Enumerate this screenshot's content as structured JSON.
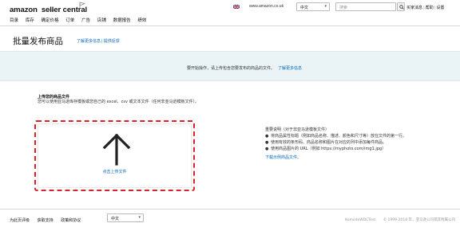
{
  "header": {
    "logo_main": "amazon",
    "logo_suffix": "seller central",
    "logo_region": "europe",
    "domain": "www.amazon.co.uk",
    "language": "中文",
    "search_placeholder": "搜索",
    "links": [
      "买家消息",
      "帮助",
      "设置"
    ]
  },
  "nav": {
    "items": [
      "目录",
      "库存",
      "确定价格",
      "订单",
      "广告",
      "店铺",
      "数据报告",
      "绩效"
    ]
  },
  "page": {
    "title": "批量发布商品",
    "links": [
      "了解更多信息",
      "提供反馈"
    ]
  },
  "banner": {
    "text": "要开始操作，请上传包含您要发布的商品的文件。",
    "link": "了解更多信息"
  },
  "upload": {
    "heading": "上传您的商品文件",
    "description": "您可以使用亚马逊库存模板或您自己的 excel、csv 或文本文件（任何非亚马逊模板文件）。",
    "button_label": "点击上传文件"
  },
  "notes": {
    "title": "重要说明（对于非亚马逊模板文件）",
    "items": [
      "将商品属性标题（例如商品名称、描述、颜色和尺寸等）放在文件的第一行。",
      "使用有效的条形码、商品名称和图片在对应的列中添加每件商品。",
      "使用商品图片的 URL（例如 https://myphoto.com/img1.jpg）"
    ],
    "link": "下载示例商品文件。"
  },
  "footer": {
    "links": [
      "为此页评级",
      "获取支持",
      "政策和协议"
    ],
    "language": "中文",
    "store": "KomodoWDCTest",
    "copyright": "© 1999-2018 年，亚马逊公司或其附属公司"
  },
  "colors": {
    "accent_red": "#d8232a",
    "link_blue": "#0066c0",
    "banner_bg": "#eaf4f6"
  }
}
